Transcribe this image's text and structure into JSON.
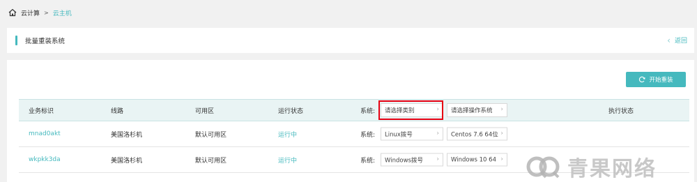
{
  "breadcrumb": {
    "root": "云计算",
    "separator": ">",
    "current": "云主机"
  },
  "header": {
    "title": "批量重装系统",
    "back_label": "返回"
  },
  "toolbar": {
    "start_label": "开始重装"
  },
  "table": {
    "columns": {
      "id": "业务标识",
      "line": "线路",
      "zone": "可用区",
      "status": "运行状态",
      "system": "系统:",
      "exec_status": "执行状态"
    },
    "header_category_placeholder": "请选择类别",
    "header_os_placeholder": "请选择操作系统",
    "rows": [
      {
        "id": "mnad0akt",
        "line": "美国洛杉机",
        "zone": "默认可用区",
        "status": "运行中",
        "system_label": "系统:",
        "category": "Linux拨号",
        "os": "Centos 7.6 64位"
      },
      {
        "id": "wkpkk3da",
        "line": "美国洛杉机",
        "zone": "默认可用区",
        "status": "运行中",
        "system_label": "系统:",
        "category": "Windows拨号",
        "os": "Windows 10 64"
      }
    ]
  },
  "watermark": {
    "text": "青果网络"
  },
  "colors": {
    "accent": "#45b9be",
    "highlight": "#e60012",
    "header_bg": "#e9f4f4"
  }
}
